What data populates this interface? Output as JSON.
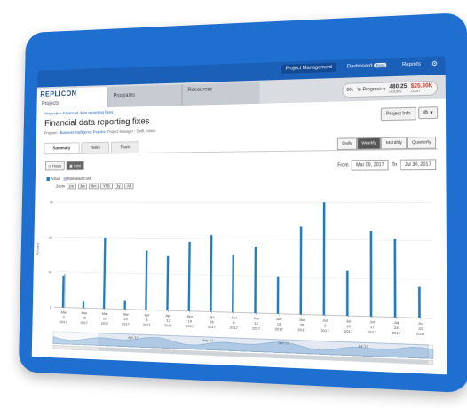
{
  "topnav": {
    "project_management": "Project Management",
    "dashboard": "Dashboard",
    "dashboard_badge": "Beta",
    "reports": "Reports"
  },
  "brand": {
    "logo": "REPLICON"
  },
  "tabs": {
    "projects": "Projects",
    "programs": "Programs",
    "resources": "Resources"
  },
  "status": {
    "percent": "0%",
    "state": "In-Progress",
    "hours_value": "480.25",
    "hours_label": "HOURS",
    "cost_value": "$25.30K",
    "cost_label": "COST"
  },
  "breadcrumb": "Projects » Financial data reporting fixes",
  "project": {
    "title": "Financial data reporting fixes",
    "program_label": "Program -",
    "program_value": "Business Intelligence Practice",
    "manager": "Project Manager - Swift, Aimee"
  },
  "buttons": {
    "project_info": "Project Info",
    "gear": "⚙ ▾"
  },
  "subtabs": [
    "Summary",
    "Tasks",
    "Team"
  ],
  "periods": [
    "Daily",
    "Weekly",
    "Monthly",
    "Quarterly"
  ],
  "active_period": "Weekly",
  "toggle": {
    "hours": "Hours",
    "cost": "Cost"
  },
  "dates": {
    "from_label": "From",
    "from": "Mar 09, 2017",
    "to_label": "To",
    "to": "Jul 30, 2017"
  },
  "legend": {
    "actual": "Actual",
    "estimated": "Estimated Cost"
  },
  "zoom": {
    "label": "Zoom",
    "options": [
      "1m",
      "3m",
      "6m",
      "YTD",
      "1y",
      "All"
    ]
  },
  "colors": {
    "actual": "#1f7bbd",
    "estimated": "#b9c4d4",
    "brand": "#1a5fb8"
  },
  "chart_data": {
    "type": "bar",
    "ylabel": "Amount",
    "ytick_labels": [
      "0",
      "1K",
      "2K",
      "3K"
    ],
    "ylim": [
      0,
      3300
    ],
    "xtick_labels": [
      [
        "Mar",
        "9",
        "2017"
      ],
      [
        "Mar",
        "15",
        "2017"
      ],
      [
        "Mar",
        "22",
        "2017"
      ],
      [
        "Mar",
        "29",
        "2017"
      ],
      [
        "Apr",
        "5",
        "2017"
      ],
      [
        "Apr",
        "12",
        "2017"
      ],
      [
        "Apr",
        "19",
        "2017"
      ],
      [
        "Apr",
        "26",
        "2017"
      ],
      [
        "Jun",
        "5",
        "2017"
      ],
      [
        "Jun",
        "12",
        "2017"
      ],
      [
        "Jun",
        "19",
        "2017"
      ],
      [
        "Jun",
        "26",
        "2017"
      ],
      [
        "Jul",
        "3",
        "2017"
      ],
      [
        "Jul",
        "10",
        "2017"
      ],
      [
        "Jul",
        "17",
        "2017"
      ],
      [
        "Jul",
        "24",
        "2017"
      ],
      [
        "Jul",
        "31",
        "2017"
      ]
    ],
    "series": [
      {
        "name": "Actual",
        "values": [
          900,
          200,
          2000,
          250,
          1650,
          1500,
          1900,
          2100,
          1550,
          1800,
          1000,
          2350,
          3000,
          1200,
          2250,
          2050,
          800
        ]
      },
      {
        "name": "Estimated Cost",
        "values": [
          950,
          0,
          0,
          0,
          0,
          0,
          0,
          0,
          0,
          0,
          0,
          0,
          0,
          0,
          0,
          0,
          0
        ]
      }
    ],
    "navigator_labels": [
      "Apr '17",
      "May '17",
      "Jun '17",
      "Jul '17"
    ]
  }
}
